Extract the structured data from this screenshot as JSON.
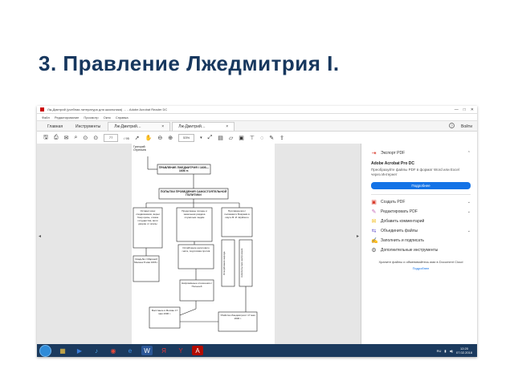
{
  "slide": {
    "title": "3. Правление Лжедмитрия I."
  },
  "window": {
    "title": "Лж-Дмитрий (учебная литература для школьника) …  - Adobe Acrobat Reader DC",
    "controls": [
      "—",
      "□",
      "✕"
    ]
  },
  "menu": [
    "Файл",
    "Редактирование",
    "Просмотр",
    "Окно",
    "Справка"
  ],
  "tabs": {
    "home": "Главная",
    "tools": "Инструменты",
    "doc1": "Лж-Дмитрий…",
    "doc2": "Лж-Дмитрий…",
    "doc_close": "×",
    "help_icon": "help-icon",
    "login": "Войти"
  },
  "toolbar": {
    "page_current": "77",
    "page_total": "/ 95",
    "zoom": "53%",
    "zoom_arrow": "▾"
  },
  "right_panel": {
    "export_pdf": "Экспорт PDF",
    "promo_title": "Adobe Acrobat Pro DC",
    "promo_text": "Преобразуйте файлы PDF в формат Word или Excel через Интернет",
    "trial_button": "Подробнее",
    "items": [
      {
        "icon": "▣",
        "label": "Создать PDF",
        "color": "#d93a2b"
      },
      {
        "icon": "✎",
        "label": "Редактировать PDF",
        "color": "#c66ab8"
      },
      {
        "icon": "✉",
        "label": "Добавить комментарий",
        "color": "#f0b400"
      },
      {
        "icon": "⇆",
        "label": "Объединить файлы",
        "color": "#6a5acd"
      },
      {
        "icon": "✍",
        "label": "Заполнить и подписать",
        "color": "#b04ab0"
      },
      {
        "icon": "⚙",
        "label": "Дополнительные инструменты",
        "color": "#555555"
      }
    ],
    "footer_text": "Храните файлы и обменивайтесь ими в Document Cloud",
    "footer_link": "Подробнее"
  },
  "diagram": {
    "top_label": "Григорий Отрепьев",
    "title": "ПРАВЛЕНИЕ ЛЖЕДМИТРИЯ I 1605—1606 гг.",
    "policy": "ПОПЫТКИ ПРОВЕДЕНИЯ САМОСТОЯТЕЛЬНОЙ ПОЛИТИКИ",
    "branch_left": "Оставил всех сподвижников, верни бояр кровь, отказа государства, вели дворян от опалы",
    "branch_middle": "Продолжены походы и земельная раздача служилым людям",
    "branch_right": "Противоречия с поляками и Боярами в смуте В. И. Шуйского",
    "mid_middle": "Ослабление налогового гнёта, подготовка против",
    "left_low": "Свадьба с Мариной Мнишек 8 мая 1606 г.",
    "vertical_left": "Оскорбление народа",
    "vertical_right": "Антипольские настроения",
    "bottom_middle": "Напряжённые отношения с Польшей",
    "bottom_left": "Восстание в Москве 17 мая 1606 г.",
    "bottom_right": "Убийство Лжедмитрия I 17 мая 1606 г."
  },
  "taskbar": {
    "apps": [
      {
        "name": "explorer-app",
        "glyph": "▦",
        "color": "#f4c542"
      },
      {
        "name": "media-app",
        "glyph": "▶",
        "color": "#3b7dd8"
      },
      {
        "name": "sound-app",
        "glyph": "♪",
        "color": "#4aa6e8"
      },
      {
        "name": "chrome-app",
        "glyph": "◉",
        "color": "#e84a3a"
      },
      {
        "name": "ie-app",
        "glyph": "e",
        "color": "#3a8ee8"
      },
      {
        "name": "word-app",
        "glyph": "W",
        "color": "#2b5797"
      },
      {
        "name": "yandex-app",
        "glyph": "Я",
        "color": "#e83a3a"
      },
      {
        "name": "yandex-browser-app",
        "glyph": "Y",
        "color": "#d42a2a"
      },
      {
        "name": "acrobat-app",
        "glyph": "A",
        "color": "#b30b00"
      }
    ],
    "lang": "RU",
    "time": "12:20",
    "date": "07.02.2018"
  }
}
